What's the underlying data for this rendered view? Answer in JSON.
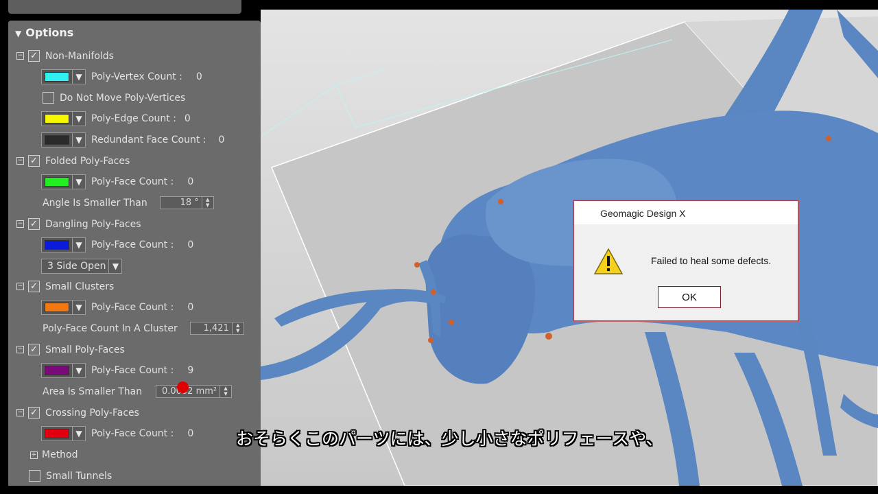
{
  "panel": {
    "title": "Options",
    "groups": {
      "non_manifolds": {
        "label": "Non-Manifolds",
        "poly_vertex_label": "Poly-Vertex Count :",
        "poly_vertex_value": "0",
        "poly_vertex_color": "#33f0f0",
        "do_not_move_label": "Do Not Move Poly-Vertices",
        "poly_edge_label": "Poly-Edge Count :",
        "poly_edge_value": "0",
        "poly_edge_color": "#f7f700",
        "redundant_label": "Redundant Face Count :",
        "redundant_value": "0",
        "redundant_color": "#2a2a2a"
      },
      "folded": {
        "label": "Folded Poly-Faces",
        "count_label": "Poly-Face Count :",
        "count_value": "0",
        "color": "#22ee22",
        "angle_label": "Angle Is Smaller Than",
        "angle_value": "18 °"
      },
      "dangling": {
        "label": "Dangling Poly-Faces",
        "count_label": "Poly-Face Count :",
        "count_value": "0",
        "color": "#0a1bdc",
        "side_select": "3 Side Open"
      },
      "small_clusters": {
        "label": "Small Clusters",
        "count_label": "Poly-Face Count :",
        "count_value": "0",
        "color": "#f07a10",
        "cluster_label": "Poly-Face Count In A Cluster",
        "cluster_value": "1,421"
      },
      "small_faces": {
        "label": "Small Poly-Faces",
        "count_label": "Poly-Face Count :",
        "count_value": "9",
        "color": "#7a0a7a",
        "area_label": "Area Is Smaller Than",
        "area_value": "0.0002 mm²"
      },
      "crossing": {
        "label": "Crossing Poly-Faces",
        "count_label": "Poly-Face Count :",
        "count_value": "0",
        "color": "#e00010"
      },
      "method_label": "Method",
      "small_tunnels_label": "Small Tunnels"
    }
  },
  "dialog": {
    "title": "Geomagic Design X",
    "message": "Failed to heal some defects.",
    "ok_label": "OK"
  },
  "subtitle": "おそらくこのパーツには、少し小さなポリフェースや、"
}
